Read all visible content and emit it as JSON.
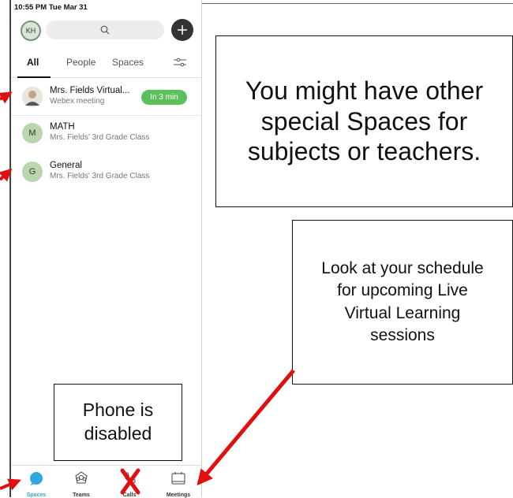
{
  "status": {
    "time": "10:55 PM  Tue Mar 31"
  },
  "header": {
    "avatar_initials": "KH"
  },
  "tabs": [
    "All",
    "People",
    "Spaces"
  ],
  "spaces": [
    {
      "avatar": "",
      "title": "Mrs. Fields Virtual...",
      "subtitle": "Webex meeting",
      "badge": "In 3 min"
    },
    {
      "avatar": "M",
      "title": "MATH",
      "subtitle": "Mrs. Fields' 3rd Grade Class"
    },
    {
      "avatar": "G",
      "title": "General",
      "subtitle": "Mrs. Fields' 3rd Grade Class"
    }
  ],
  "bottom_nav": [
    {
      "label": "Spaces",
      "icon": "chat-bubble-icon",
      "color": "#2fa8df"
    },
    {
      "label": "Teams",
      "icon": "teams-icon"
    },
    {
      "label": "Calls",
      "icon": "phone-icon"
    },
    {
      "label": "Meetings",
      "icon": "calendar-icon"
    }
  ],
  "callouts": {
    "spaces_note": "You might have other special Spaces for subjects or teachers.",
    "schedule_note": "Look at your schedule for upcoming Live Virtual Learning sessions",
    "phone_note": "Phone is disabled"
  },
  "colors": {
    "accent": "#2fa8df",
    "badge": "#5cc05c",
    "arrow": "#e01010",
    "avatar": "#b9d6ad"
  }
}
